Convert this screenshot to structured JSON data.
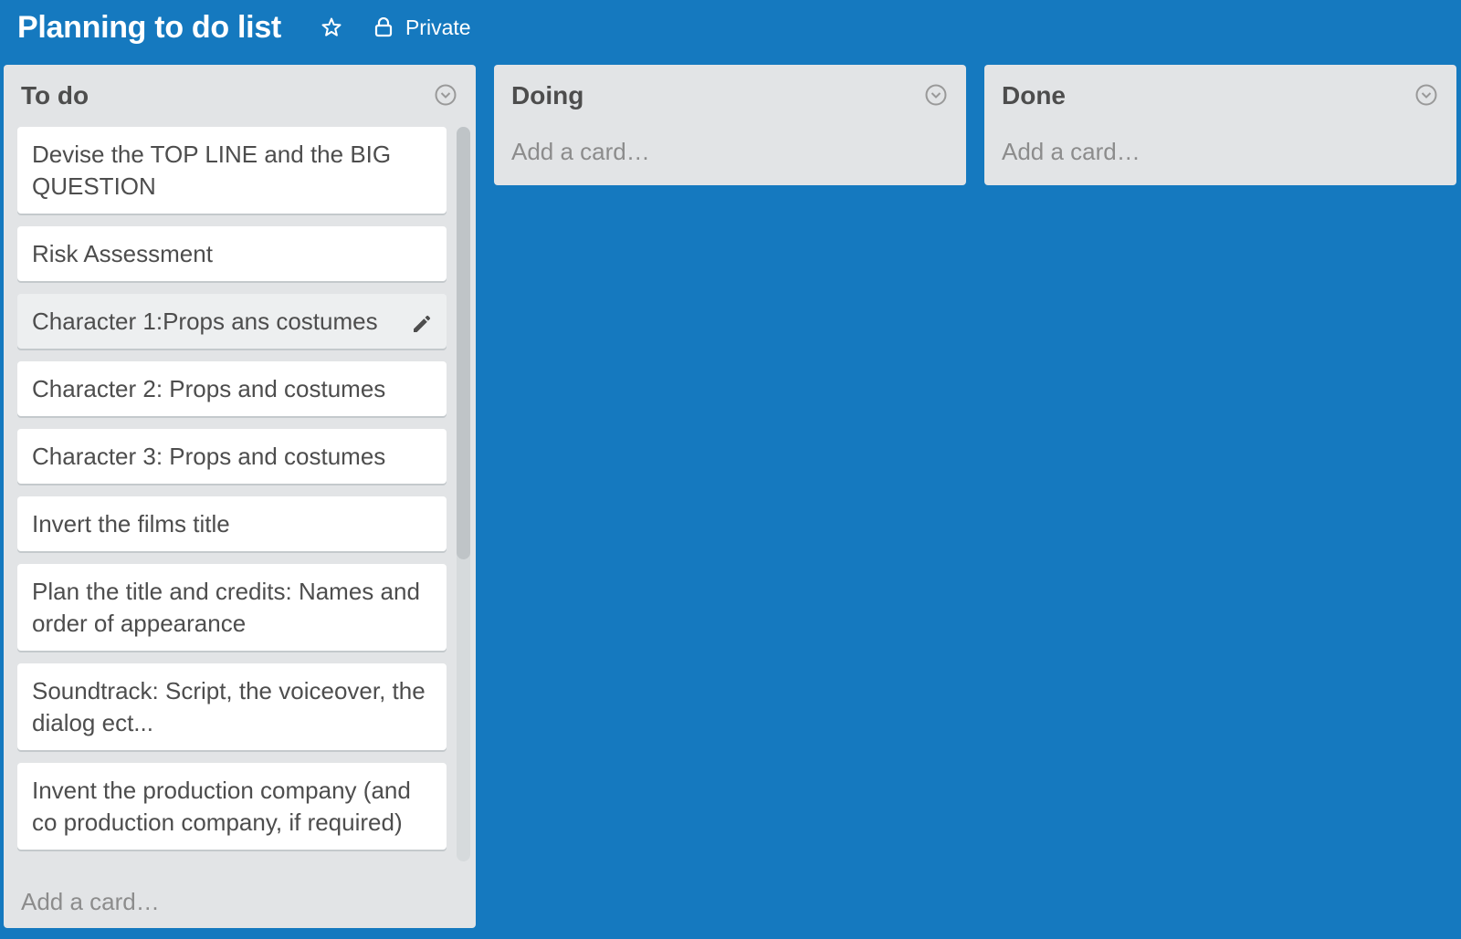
{
  "header": {
    "board_title": "Planning to do list",
    "privacy_label": "Private"
  },
  "lists": [
    {
      "title": "To do",
      "cards": [
        "Devise the TOP LINE and the BIG QUESTION",
        "Risk Assessment",
        "Character 1:Props ans costumes",
        "Character 2: Props and costumes",
        "Character 3: Props and costumes",
        "Invert the films title",
        "Plan the title and credits: Names and order of appearance",
        "Soundtrack: Script, the voiceover, the dialog ect...",
        "Invent the production company (and co production company, if required)"
      ],
      "add_card_label": "Add a card…"
    },
    {
      "title": "Doing",
      "cards": [],
      "add_card_label": "Add a card…"
    },
    {
      "title": "Done",
      "cards": [],
      "add_card_label": "Add a card…"
    }
  ],
  "colors": {
    "board_background": "#1579bf",
    "list_background": "#e2e4e6",
    "card_background": "#ffffff"
  }
}
